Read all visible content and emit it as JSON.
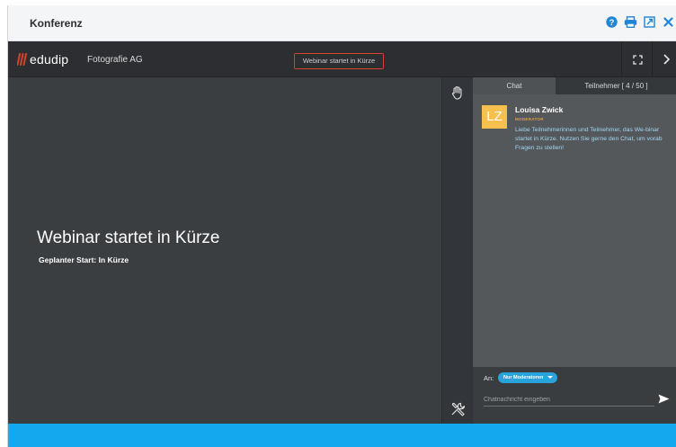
{
  "dialog": {
    "title": "Konferenz",
    "icons": [
      "help-icon",
      "print-icon",
      "popout-icon",
      "close-icon"
    ]
  },
  "topbar": {
    "logo_text": "edudip",
    "company": "Fotografie AG",
    "status": "Webinar startet in Kürze",
    "icons": [
      "fullscreen-icon",
      "chevron-right-icon"
    ]
  },
  "stage": {
    "title": "Webinar startet in Kürze",
    "subtitle": "Geplanter Start: In Kürze"
  },
  "tools": {
    "icons": [
      "hand-raise-icon",
      "tools-icon"
    ]
  },
  "panel": {
    "tabs": [
      {
        "label": "Chat"
      },
      {
        "label": "Teilnehmer [ 4 / 50 ]"
      }
    ],
    "message": {
      "initials": "LZ",
      "name": "Louisa Zwick",
      "role": "MODERATOR",
      "text": "Liebe Teilnehmerinnen und Teilnehmer, das We-binar startet in Kürze. Nutzen Sie gerne den Chat, um vorab Fragen zu stellen!"
    },
    "compose": {
      "to_label": "An:",
      "recipient": "Nur Moderatoren",
      "placeholder": "Chatnachricht eingeben",
      "value": ""
    }
  },
  "colors": {
    "accent_blue": "#14a8ee",
    "logo_red": "#d2452b",
    "avatar_yellow": "#f5c04d",
    "pill_blue": "#2aa3dc"
  }
}
